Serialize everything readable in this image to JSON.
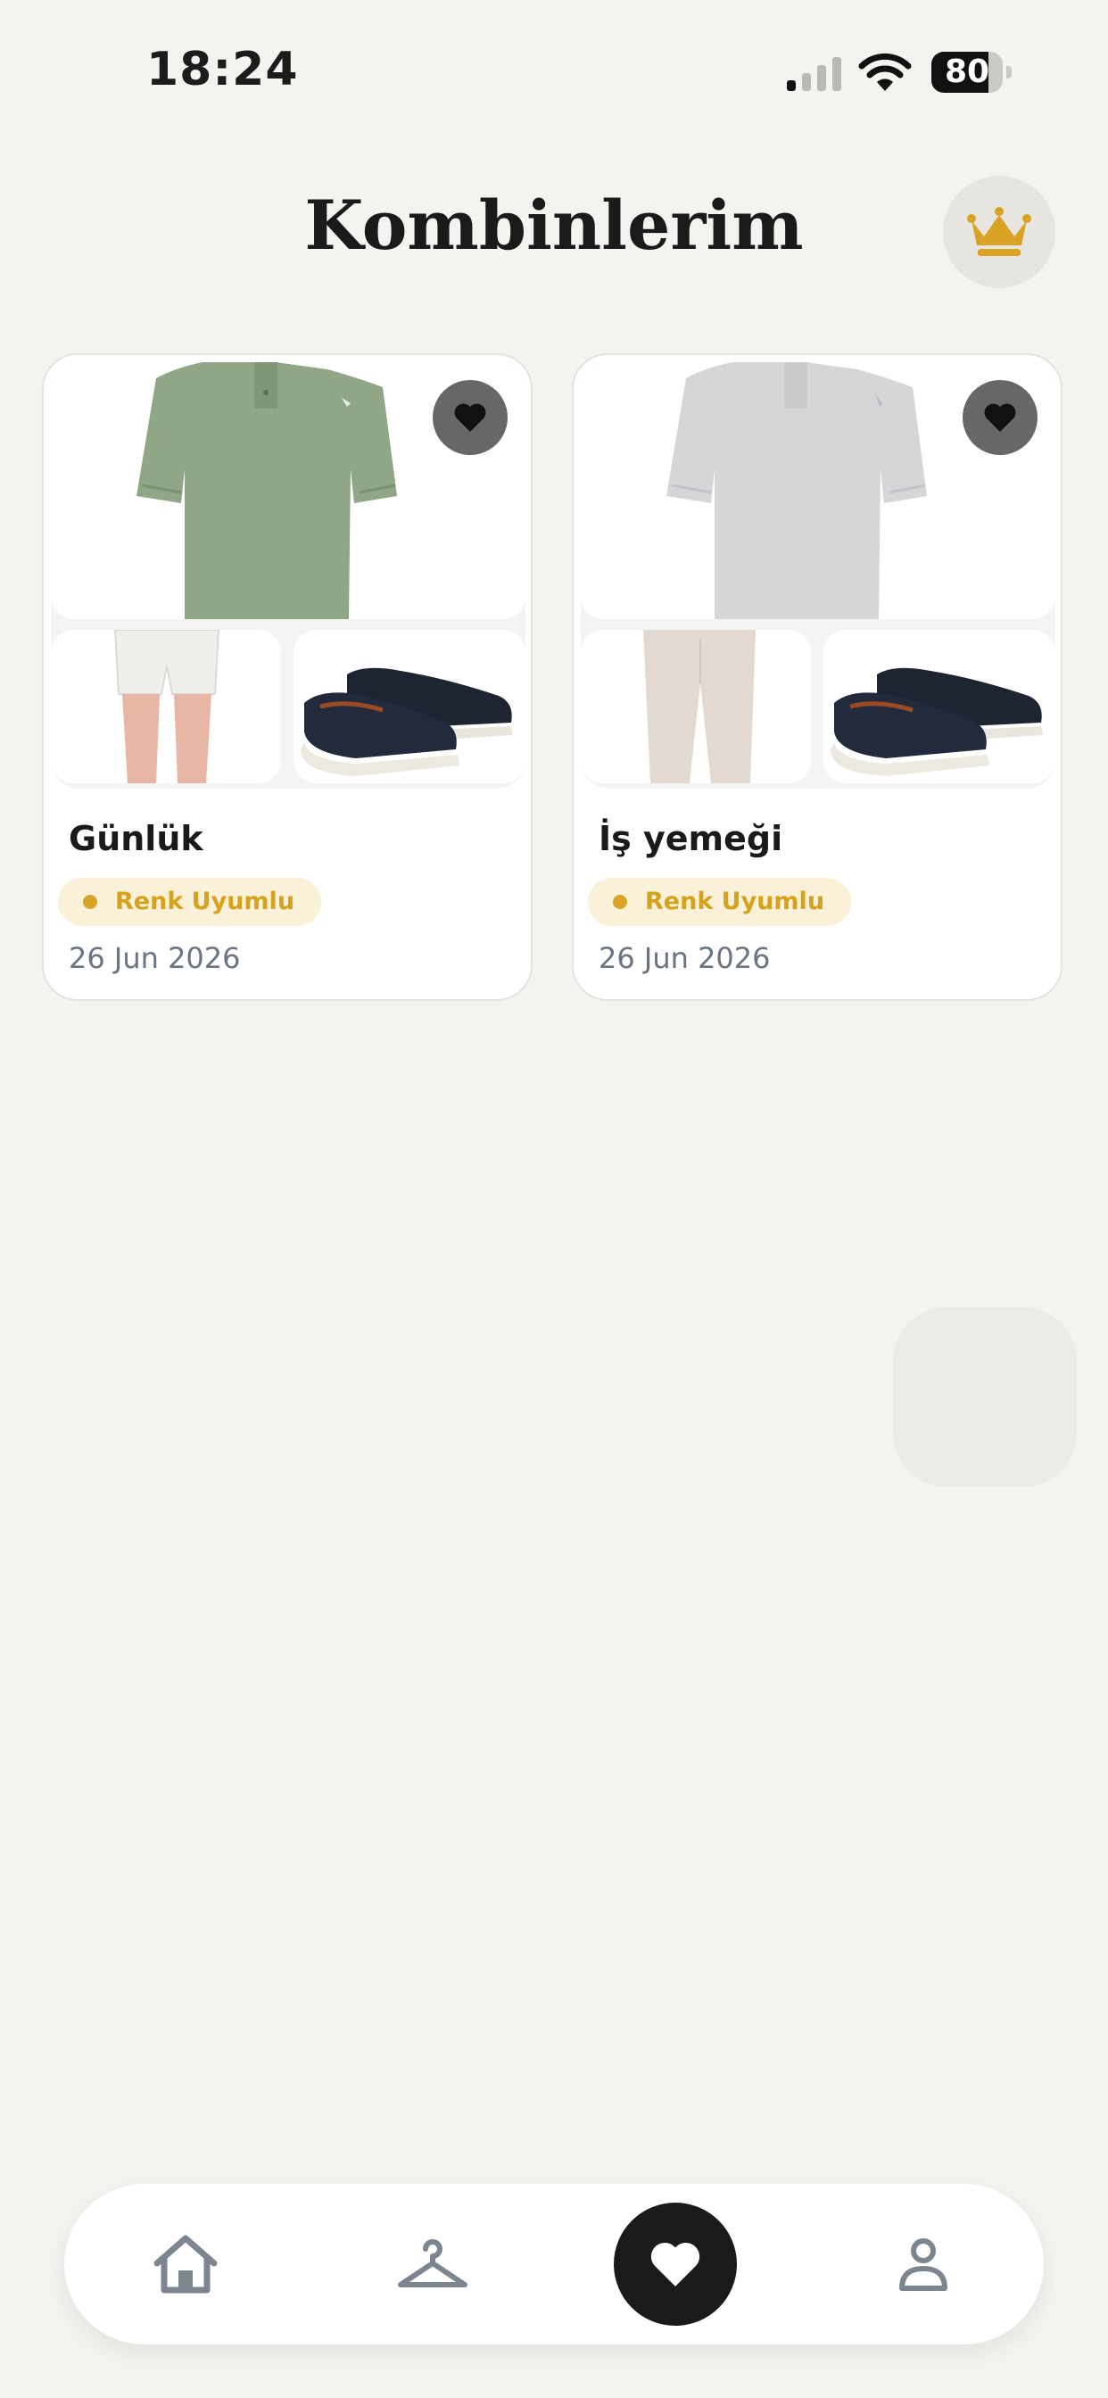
{
  "status_bar": {
    "time": "18:24",
    "battery": "80",
    "battery_level": 0.8
  },
  "header": {
    "title": "Kombinlerim",
    "premium_icon": "crown-icon"
  },
  "outfits": [
    {
      "title": "Günlük",
      "badge": "Renk Uyumlu",
      "date": "26 Jun 2026",
      "favorited": true,
      "items": [
        "green polo shirt",
        "white shorts",
        "navy loafers"
      ],
      "colors": {
        "top": "#8fa786",
        "bottom": "#f0efec",
        "shoes": "#1f2433"
      }
    },
    {
      "title": "İş yemeği",
      "badge": "Renk Uyumlu",
      "date": "26 Jun 2026",
      "favorited": true,
      "items": [
        "light grey polo shirt",
        "beige trousers",
        "navy loafers"
      ],
      "colors": {
        "top": "#d6d5d8",
        "bottom": "#e2d9d2",
        "shoes": "#1f2433"
      }
    }
  ],
  "tab_bar": {
    "tabs": [
      {
        "name": "home",
        "icon": "home-icon",
        "active": false
      },
      {
        "name": "wardrobe",
        "icon": "hanger-icon",
        "active": false
      },
      {
        "name": "favorites",
        "icon": "heart-icon",
        "active": true
      },
      {
        "name": "profile",
        "icon": "person-icon",
        "active": false
      }
    ]
  },
  "theme": {
    "accent": "#d9a426",
    "badge_bg": "#fbf1d8",
    "background": "#f3f3ef",
    "date_color": "#6b7480"
  }
}
